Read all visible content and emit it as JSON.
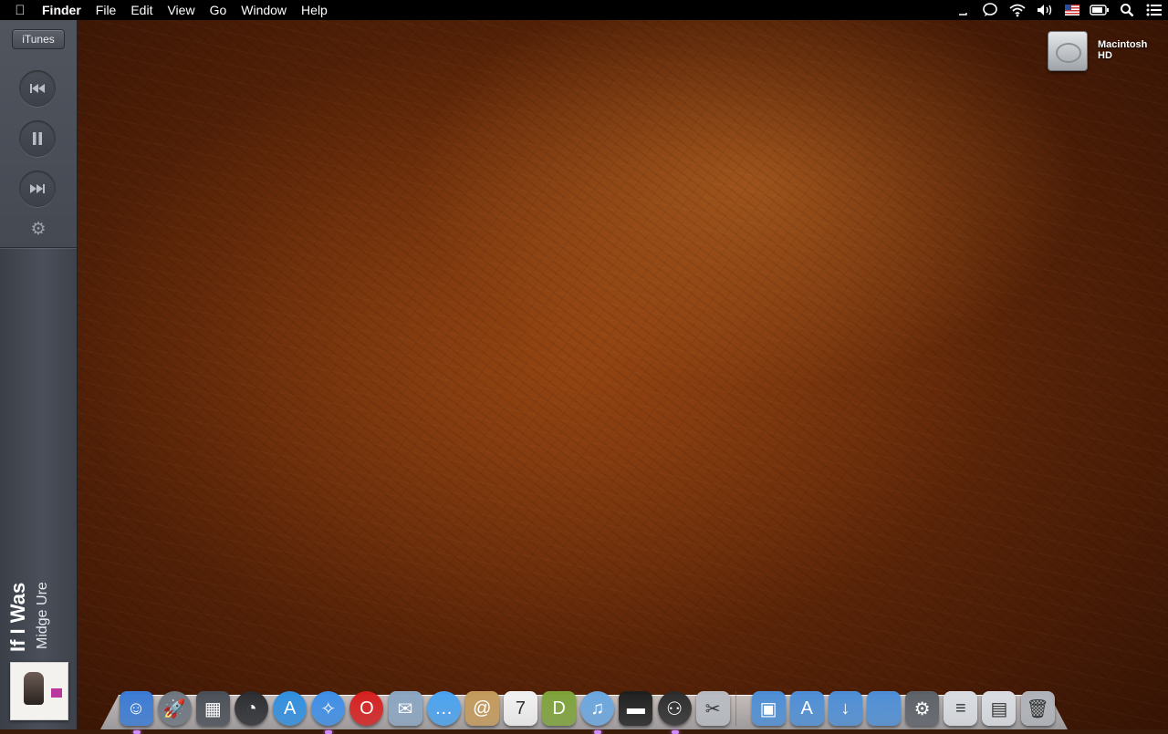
{
  "menubar": {
    "app_name": "Finder",
    "items": [
      "File",
      "Edit",
      "View",
      "Go",
      "Window",
      "Help"
    ]
  },
  "status_icons": [
    "time-machine-icon",
    "chat-icon",
    "wifi-icon",
    "volume-icon",
    "us-flag-input-icon",
    "battery-icon",
    "spotlight-icon",
    "notification-center-icon"
  ],
  "itunes": {
    "label": "iTunes",
    "track_title": "If I Was",
    "track_artist": "Midge Ure"
  },
  "desktop": {
    "hd_label": "Macintosh HD"
  },
  "dock": {
    "apps": [
      {
        "name": "finder",
        "icon": "☺",
        "color": "#3a7bd5"
      },
      {
        "name": "launchpad",
        "icon": "🚀",
        "color": "#6e7680"
      },
      {
        "name": "mission-control",
        "icon": "▦",
        "color": "#4a4f57"
      },
      {
        "name": "dashboard",
        "icon": "◔",
        "color": "#2a2c30"
      },
      {
        "name": "app-store",
        "icon": "A",
        "color": "#2f8fe0"
      },
      {
        "name": "safari",
        "icon": "✧",
        "color": "#3d8ee8"
      },
      {
        "name": "opera",
        "icon": "O",
        "color": "#d61f1f"
      },
      {
        "name": "mail",
        "icon": "✉",
        "color": "#8ba6c2"
      },
      {
        "name": "messages",
        "icon": "…",
        "color": "#4aa3f0"
      },
      {
        "name": "contacts",
        "icon": "@",
        "color": "#c49a5c"
      },
      {
        "name": "calendar",
        "icon": "7",
        "color": "#f2f2f2"
      },
      {
        "name": "dictionary",
        "icon": "D",
        "color": "#7ea33a"
      },
      {
        "name": "itunes",
        "icon": "♫",
        "color": "#6aa7e0"
      },
      {
        "name": "terminal",
        "icon": "▬",
        "color": "#1f1f1f"
      },
      {
        "name": "alfred",
        "icon": "⚇",
        "color": "#2c2c2c"
      },
      {
        "name": "screenshot-utility",
        "icon": "✂",
        "color": "#b8bcc2"
      }
    ],
    "folders": [
      {
        "name": "pictures-folder",
        "icon": "▣",
        "color": "#4d8ed6"
      },
      {
        "name": "applications-folder",
        "icon": "A",
        "color": "#4d8ed6"
      },
      {
        "name": "downloads-folder",
        "icon": "↓",
        "color": "#4d8ed6"
      },
      {
        "name": "apple-folder",
        "icon": "",
        "color": "#4d8ed6"
      },
      {
        "name": "system-preferences-stack",
        "icon": "⚙",
        "color": "#5c6168"
      },
      {
        "name": "documents-stack",
        "icon": "≡",
        "color": "#d9dde2"
      },
      {
        "name": "screenshots-stack",
        "icon": "▤",
        "color": "#d9dde2"
      },
      {
        "name": "trash",
        "icon": "🗑",
        "color": "#b0b4ba"
      }
    ],
    "running": [
      "finder",
      "safari",
      "itunes",
      "alfred"
    ]
  }
}
